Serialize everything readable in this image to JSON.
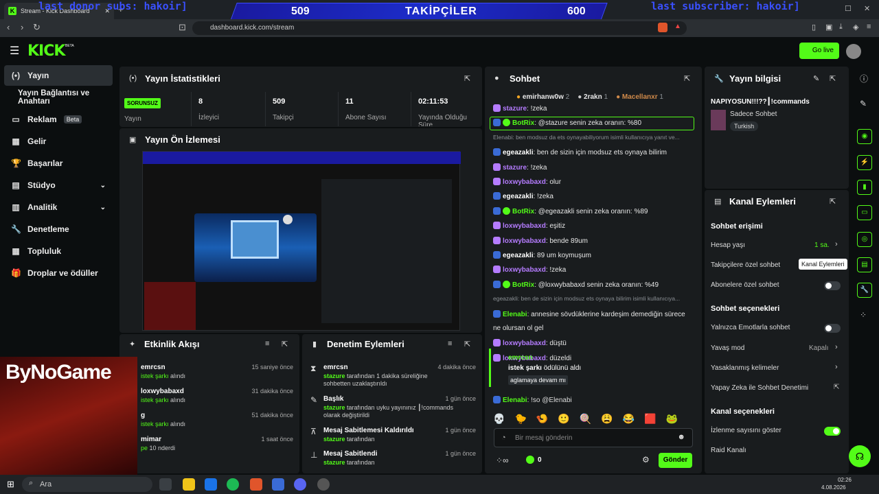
{
  "browser": {
    "tab_title": "Stream - Kick Dashboard",
    "url": "dashboard.kick.com/stream"
  },
  "overlay": {
    "ticker_left": "last donor subs: hakoir]",
    "ticker_right": "last subscriber: hakoir]",
    "count_left": "509",
    "title": "TAKİPÇİLER",
    "count_right": "600",
    "watermark": "ByNoGame"
  },
  "header": {
    "logo": "KICK",
    "logo_tag": "BETA",
    "go_live": "Go live"
  },
  "sidebar": {
    "items": [
      {
        "label": "Yayın",
        "icon": "broadcast-icon"
      },
      {
        "label": "Yayın Bağlantısı ve Anahtarı",
        "icon": ""
      },
      {
        "label": "Reklam",
        "badge": "Beta",
        "icon": "tv-icon"
      },
      {
        "label": "Gelir",
        "icon": "grid-icon"
      },
      {
        "label": "Başarılar",
        "icon": "trophy-icon"
      },
      {
        "label": "Stüdyo",
        "icon": "studio-icon"
      },
      {
        "label": "Analitik",
        "icon": "chart-icon"
      },
      {
        "label": "Denetleme",
        "icon": "wrench-icon"
      },
      {
        "label": "Topluluk",
        "icon": "community-icon"
      },
      {
        "label": "Droplar ve ödüller",
        "icon": "gift-icon"
      }
    ]
  },
  "stats": {
    "title": "Yayın İstatistikleri",
    "status": "SORUNSUZ",
    "status_label": "Yayın",
    "items": [
      {
        "value": "8",
        "label": "İzleyici"
      },
      {
        "value": "509",
        "label": "Takipçi"
      },
      {
        "value": "11",
        "label": "Abone Sayısı"
      },
      {
        "value": "02:11:53",
        "label": "Yayında Olduğu Süre"
      }
    ]
  },
  "preview": {
    "title": "Yayın Ön İzlemesi"
  },
  "activity": {
    "title": "Etkinlik Akışı",
    "items": [
      {
        "user": "emrcsn",
        "action": "istek şarkı",
        "suffix": "alındı",
        "time": "15 saniye önce"
      },
      {
        "user": "loxwybabaxd",
        "action": "istek şarkı",
        "suffix": "alındı",
        "time": "31 dakika önce"
      },
      {
        "user": "g",
        "action": "istek şarkı",
        "suffix": "alındı",
        "time": "51 dakika önce"
      },
      {
        "user": "mimar",
        "action": "pe",
        "suffix": "10 nderdi",
        "time": "1 saat önce"
      }
    ]
  },
  "moderation": {
    "title": "Denetim Eylemleri",
    "items": [
      {
        "title": "emrcsn",
        "actor": "stazure",
        "desc": "tarafından 1 dakika süreliğine sohbetten uzaklaştırıldı",
        "time": "4 dakika önce"
      },
      {
        "title": "Başlık",
        "actor": "stazure",
        "desc": "tarafından uyku yayınınız ┃!commands olarak değiştirildi",
        "time": "1 gün önce"
      },
      {
        "title": "Mesaj Sabitlemesi Kaldırıldı",
        "actor": "stazure",
        "desc": "tarafından",
        "time": "1 gün önce"
      },
      {
        "title": "Mesaj Sabitlendi",
        "actor": "stazure",
        "desc": "tarafından",
        "time": "1 gün önce"
      }
    ]
  },
  "chat": {
    "title": "Sohbet",
    "top": [
      {
        "name": "emirhanw0w",
        "n": "2"
      },
      {
        "name": "2rakn",
        "n": "1"
      },
      {
        "name": "Macellanxr",
        "n": "1"
      }
    ],
    "messages": [
      {
        "user": "stazure",
        "text": ": !zeka",
        "color": "purple"
      },
      {
        "user": "BotRix",
        "text": ": @stazure senin zeka oranın: %80",
        "color": "green"
      },
      {
        "user": "",
        "text": "Elenabi: ben modsuz da ets oynayabiliyorum isimli kullanıcıya yanıt ve...",
        "color": "grey"
      },
      {
        "user": "egeazakli",
        "text": ": ben de sizin için modsuz ets oynaya bilirim",
        "color": "white"
      },
      {
        "user": "stazure",
        "text": ": !zeka",
        "color": "purple"
      },
      {
        "user": "loxwybabaxd",
        "text": ": olur",
        "color": "purple"
      },
      {
        "user": "egeazakli",
        "text": ": !zeka",
        "color": "white"
      },
      {
        "user": "BotRix",
        "text": ": @egeazakli senin zeka oranın: %89",
        "color": "green"
      },
      {
        "user": "loxwybabaxd",
        "text": ": eşitiz",
        "color": "purple"
      },
      {
        "user": "loxwybabaxd",
        "text": ": bende 89um",
        "color": "purple"
      },
      {
        "user": "egeazakli",
        "text": ": 89 um koymuşum",
        "color": "white"
      },
      {
        "user": "loxwybabaxd",
        "text": ": !zeka",
        "color": "purple"
      },
      {
        "user": "BotRix",
        "text": ": @loxwybabaxd senin zeka oranın: %49",
        "color": "green"
      },
      {
        "user": "",
        "text": "egeazakli: ben de sizin için modsuz ets oynaya bilirim isimli kullanıcıya...",
        "color": "grey"
      },
      {
        "user": "Elenabi",
        "text": ": annesine sövdüklerine kardeşim demediğin sürece",
        "color": "green"
      },
      {
        "user": "",
        "text": "ne olursan ol gel",
        "color": "white"
      },
      {
        "user": "loxwybabaxd",
        "text": ": düştü",
        "color": "purple"
      },
      {
        "user": "loxwybabaxd",
        "text": ": düzeldi",
        "color": "purple"
      }
    ],
    "redeem": {
      "user": "emrcsn",
      "reward": "istek şarkı",
      "suffix": "ödülünü aldı",
      "note": "aglamaya devam mı"
    },
    "last": {
      "user": "Elenabi",
      "text": ": !so @Elenabi"
    },
    "placeholder": "Bir mesaj gönderin",
    "count": "0",
    "send": "Gönder"
  },
  "info": {
    "title": "Yayın bilgisi",
    "stream_title": "NAPIYOSUN!!!??┃!commands",
    "category": "Sadece Sohbet",
    "tag": "Turkish"
  },
  "actions": {
    "title": "Kanal Eylemleri",
    "access_title": "Sohbet erişimi",
    "age_label": "Hesap yaşı",
    "age_value": "1 sa.",
    "followers_label": "Takipçilere özel sohbet",
    "subs_label": "Abonelere özel sohbet",
    "tooltip": "Kanal Eylemleri",
    "options_title": "Sohbet seçenekleri",
    "emote_label": "Yalnızca Emotlarla sohbet",
    "slow_label": "Yavaş mod",
    "slow_value": "Kapalı",
    "banned_label": "Yasaklanmış kelimeler",
    "ai_label": "Yapay Zeka ile Sohbet Denetimi",
    "channel_title": "Kanal seçenekleri",
    "views_label": "İzlenme sayısını göster",
    "raid_label": "Raid Kanalı"
  },
  "taskbar": {
    "search": "Ara",
    "time": "02:26",
    "date": "4.08.2026"
  }
}
